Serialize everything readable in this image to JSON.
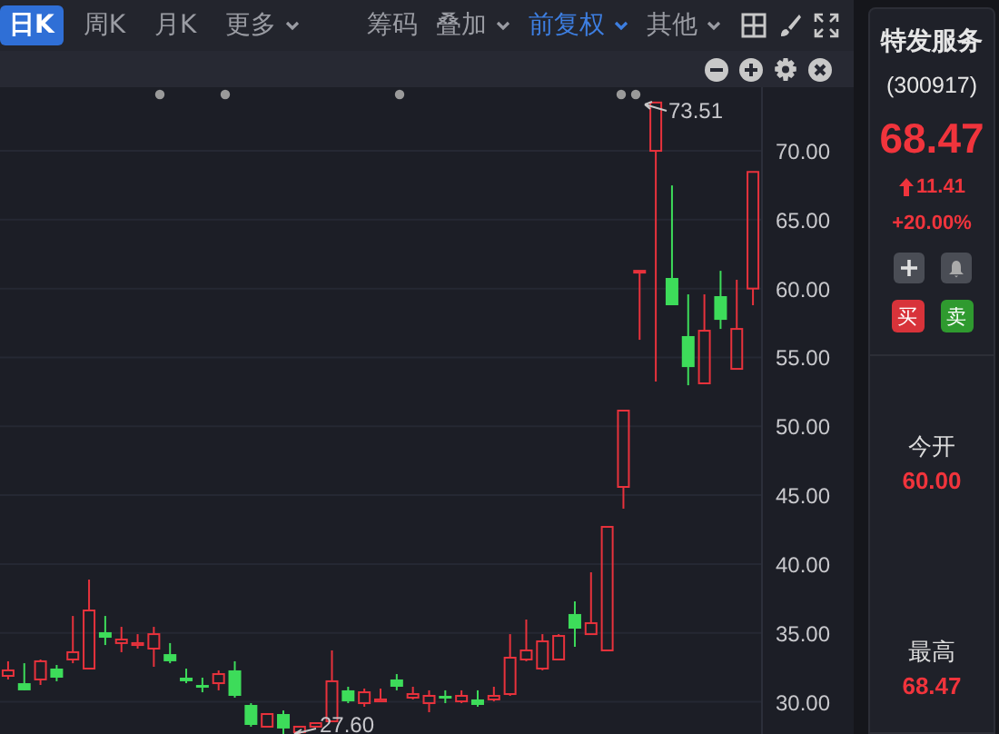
{
  "toolbar": {
    "period_tabs": [
      {
        "label": "日K",
        "selected": true
      },
      {
        "label": "周K",
        "selected": false
      },
      {
        "label": "月K",
        "selected": false
      }
    ],
    "more_menu": "更多",
    "tools": [
      {
        "label": "筹码",
        "kind": "button",
        "active": false
      },
      {
        "label": "叠加",
        "kind": "dropdown",
        "active": false
      },
      {
        "label": "前复权",
        "kind": "dropdown",
        "active": true
      },
      {
        "label": "其他",
        "kind": "dropdown",
        "active": false
      }
    ]
  },
  "chart": {
    "high_marker": "73.51",
    "low_marker": "27.60",
    "chart_data": {
      "type": "candlestick",
      "categories": [
        null,
        null,
        null,
        null,
        null,
        null,
        null,
        null,
        null,
        null,
        null,
        null,
        null,
        null,
        null,
        null,
        null,
        null,
        null,
        null,
        null,
        null,
        null,
        null,
        null,
        null,
        null,
        null,
        null,
        null,
        null,
        null,
        null,
        null,
        null,
        null,
        null,
        null,
        null,
        null,
        null,
        null,
        null,
        null,
        null,
        null,
        null
      ],
      "ohlc": [
        [
          31.88,
          32.94,
          31.62,
          32.28
        ],
        [
          31.35,
          32.8,
          30.83,
          30.83
        ],
        [
          31.62,
          33.07,
          31.22,
          32.94
        ],
        [
          32.41,
          32.67,
          31.49,
          31.75
        ],
        [
          33.07,
          36.23,
          32.8,
          33.6
        ],
        [
          32.41,
          38.87,
          32.41,
          36.63
        ],
        [
          35.05,
          36.23,
          34.12,
          34.65
        ],
        [
          34.26,
          35.44,
          33.6,
          34.52
        ],
        [
          34.12,
          34.91,
          33.86,
          34.26
        ],
        [
          33.86,
          35.44,
          32.54,
          34.91
        ],
        [
          33.46,
          34.26,
          32.8,
          32.94
        ],
        [
          31.75,
          32.41,
          31.35,
          31.49
        ],
        [
          31.22,
          31.75,
          30.69,
          31.09
        ],
        [
          31.35,
          32.28,
          30.83,
          32.01
        ],
        [
          32.28,
          32.94,
          30.3,
          30.43
        ],
        [
          29.77,
          29.9,
          28.19,
          28.32
        ],
        [
          28.19,
          29.11,
          28.19,
          29.11
        ],
        [
          29.11,
          29.37,
          27.66,
          28.06
        ],
        [
          27.79,
          28.19,
          27.6,
          28.19
        ],
        [
          28.19,
          28.45,
          28.19,
          28.45
        ],
        [
          28.58,
          33.73,
          28.58,
          31.49
        ],
        [
          30.83,
          31.09,
          29.9,
          30.03
        ],
        [
          29.9,
          30.96,
          29.64,
          30.69
        ],
        [
          30.03,
          30.96,
          30.03,
          30.17
        ],
        [
          31.62,
          32.01,
          30.83,
          31.09
        ],
        [
          30.3,
          31.09,
          30.17,
          30.56
        ],
        [
          29.9,
          30.83,
          29.24,
          30.43
        ],
        [
          30.43,
          30.83,
          29.9,
          30.3
        ],
        [
          30.03,
          30.83,
          29.9,
          30.43
        ],
        [
          30.17,
          30.83,
          29.64,
          29.77
        ],
        [
          30.17,
          31.09,
          30.03,
          30.43
        ],
        [
          30.56,
          34.91,
          30.43,
          33.2
        ],
        [
          33.07,
          35.97,
          32.94,
          33.73
        ],
        [
          32.41,
          34.91,
          32.28,
          34.39
        ],
        [
          33.07,
          34.91,
          33.07,
          34.78
        ],
        [
          36.37,
          37.29,
          33.99,
          35.31
        ],
        [
          34.91,
          39.4,
          34.91,
          35.71
        ],
        [
          33.73,
          42.7,
          33.73,
          42.7
        ],
        [
          45.6,
          51.14,
          44.02,
          51.14
        ],
        [
          61.16,
          61.29,
          56.28,
          61.29
        ],
        [
          70.0,
          73.51,
          53.25,
          73.51
        ],
        [
          60.77,
          67.49,
          58.79,
          58.79
        ],
        [
          56.55,
          59.58,
          52.98,
          54.3
        ],
        [
          53.12,
          59.58,
          53.12,
          56.94
        ],
        [
          59.45,
          61.29,
          57.07,
          57.73
        ],
        [
          54.17,
          60.64,
          54.17,
          57.07
        ],
        [
          60.0,
          68.47,
          58.79,
          68.47
        ]
      ],
      "ylim": [
        27.66,
        74.62
      ],
      "grid": true,
      "yticks": [
        {
          "value": 70,
          "label": "70.00"
        },
        {
          "value": 65,
          "label": "65.00"
        },
        {
          "value": 60,
          "label": "60.00"
        },
        {
          "value": 55,
          "label": "55.00"
        },
        {
          "value": 50,
          "label": "50.00"
        },
        {
          "value": 45,
          "label": "45.00"
        },
        {
          "value": 40,
          "label": "40.00"
        },
        {
          "value": 35,
          "label": "35.00"
        },
        {
          "value": 30,
          "label": "30.00"
        }
      ]
    }
  },
  "quote": {
    "name": "特发服务",
    "code": "(300917)",
    "price": "68.47",
    "change": "11.41",
    "change_percent": "+20.00%",
    "buy": "买",
    "sell": "卖",
    "stats": [
      {
        "label": "今开",
        "value": "60.00"
      },
      {
        "label": "最高",
        "value": "68.47"
      }
    ]
  }
}
